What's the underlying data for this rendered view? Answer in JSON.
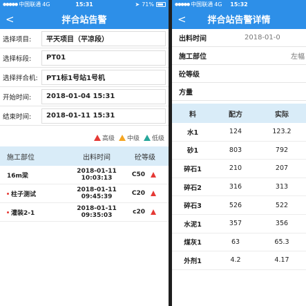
{
  "left": {
    "status": {
      "carrier": "中国联通",
      "network": "4G",
      "time": "15:31",
      "battery": "71%"
    },
    "nav": {
      "back": "<",
      "title": "拌合站告警"
    },
    "form": [
      {
        "label": "选择项目:",
        "value": "平天项目（平凉段）"
      },
      {
        "label": "选择标段:",
        "value": "PT01"
      },
      {
        "label": "选择拌合机:",
        "value": "PT1标1号站1号机"
      },
      {
        "label": "开始时间:",
        "value": "2018-01-04 15:31"
      },
      {
        "label": "结束时间:",
        "value": "2018-01-11 15:31"
      }
    ],
    "legend": {
      "high": "高级",
      "mid": "中级",
      "low": "低级"
    },
    "table": {
      "headers": [
        "施工部位",
        "出料时间",
        "砼等级"
      ],
      "rows": [
        {
          "part": "16m梁",
          "time": "2018-01-11 10:03:13",
          "grade": "C50"
        },
        {
          "part": "柱子测试",
          "time": "2018-01-11 09:45:39",
          "grade": "C20"
        },
        {
          "part": "灌装2-1",
          "time": "2018-01-11 09:35:03",
          "grade": "c20"
        }
      ]
    }
  },
  "right": {
    "status": {
      "carrier": "中国联通",
      "network": "4G",
      "time": "15:32"
    },
    "nav": {
      "back": "<",
      "title": "拌合站告警详情"
    },
    "fields": [
      {
        "label": "出料时间",
        "value": "2018-01-0"
      },
      {
        "label": "施工部位",
        "value": "左幅"
      },
      {
        "label": "砼等级",
        "value": ""
      },
      {
        "label": "方量",
        "value": ""
      }
    ],
    "table": {
      "headers": [
        "料",
        "配方",
        "实际"
      ],
      "rows": [
        {
          "name": "水1",
          "recipe": "124",
          "actual": "123.2"
        },
        {
          "name": "砂1",
          "recipe": "803",
          "actual": "792"
        },
        {
          "name": "碎石1",
          "recipe": "210",
          "actual": "207"
        },
        {
          "name": "碎石2",
          "recipe": "316",
          "actual": "313"
        },
        {
          "name": "碎石3",
          "recipe": "526",
          "actual": "522"
        },
        {
          "name": "水泥1",
          "recipe": "357",
          "actual": "356"
        },
        {
          "name": "煤灰1",
          "recipe": "63",
          "actual": "65.3"
        },
        {
          "name": "外剂1",
          "recipe": "4.2",
          "actual": "4.17"
        }
      ]
    }
  }
}
